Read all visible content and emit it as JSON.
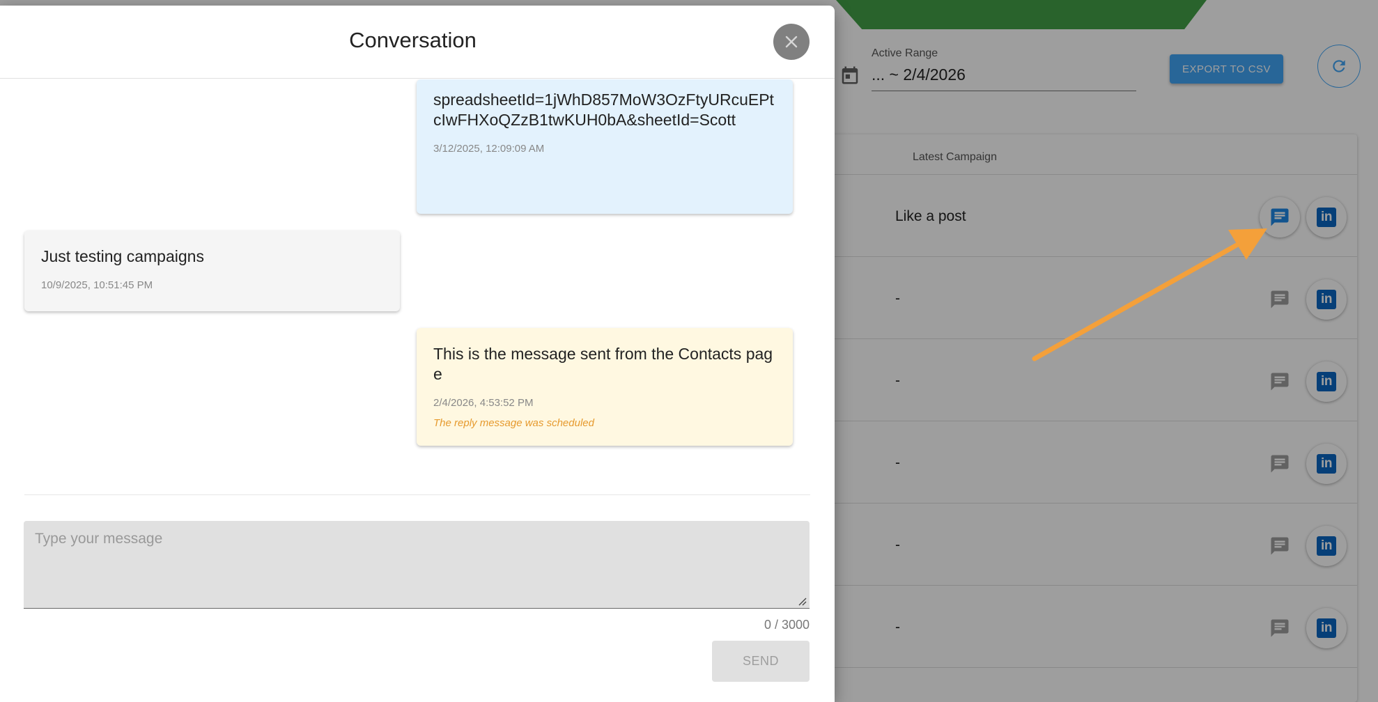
{
  "background": {
    "filter": {
      "label": "Active Range",
      "value": "... ~ 2/4/2026"
    },
    "export_button": "EXPORT TO CSV",
    "table": {
      "column_header": "Latest Campaign",
      "rows": [
        {
          "campaign": "Like a post",
          "message_icon_active": true
        },
        {
          "campaign": "-",
          "message_icon_active": false
        },
        {
          "campaign": "-",
          "message_icon_active": false
        },
        {
          "campaign": "-",
          "message_icon_active": false
        },
        {
          "campaign": "-",
          "message_icon_active": false
        },
        {
          "campaign": "-",
          "message_icon_active": false
        }
      ]
    },
    "colors": {
      "accent": "#42a5f5",
      "linkedin": "#0a66c2",
      "annotation_arrow": "#f4a03a",
      "banner": "#43a047"
    }
  },
  "modal": {
    "title": "Conversation",
    "messages": [
      {
        "side": "right",
        "text": "spreadsheetId=1jWhD857MoW3OzFtyURcuEPtcIwFHXoQZzB1twKUH0bA&sheetId=Scott",
        "time": "3/12/2025, 12:09:09 AM",
        "color": "#e3f2fd"
      },
      {
        "side": "left",
        "text": "Just testing campaigns",
        "time": "10/9/2025, 10:51:45 PM",
        "color": "#f5f5f5"
      },
      {
        "side": "right",
        "text": "This is the message sent from the Contacts page",
        "time": "2/4/2026, 4:53:52 PM",
        "note": "The reply message was scheduled",
        "color": "#fff8e1"
      }
    ],
    "input": {
      "placeholder": "Type your message",
      "value": ""
    },
    "counter": "0 / 3000",
    "send_label": "SEND"
  }
}
